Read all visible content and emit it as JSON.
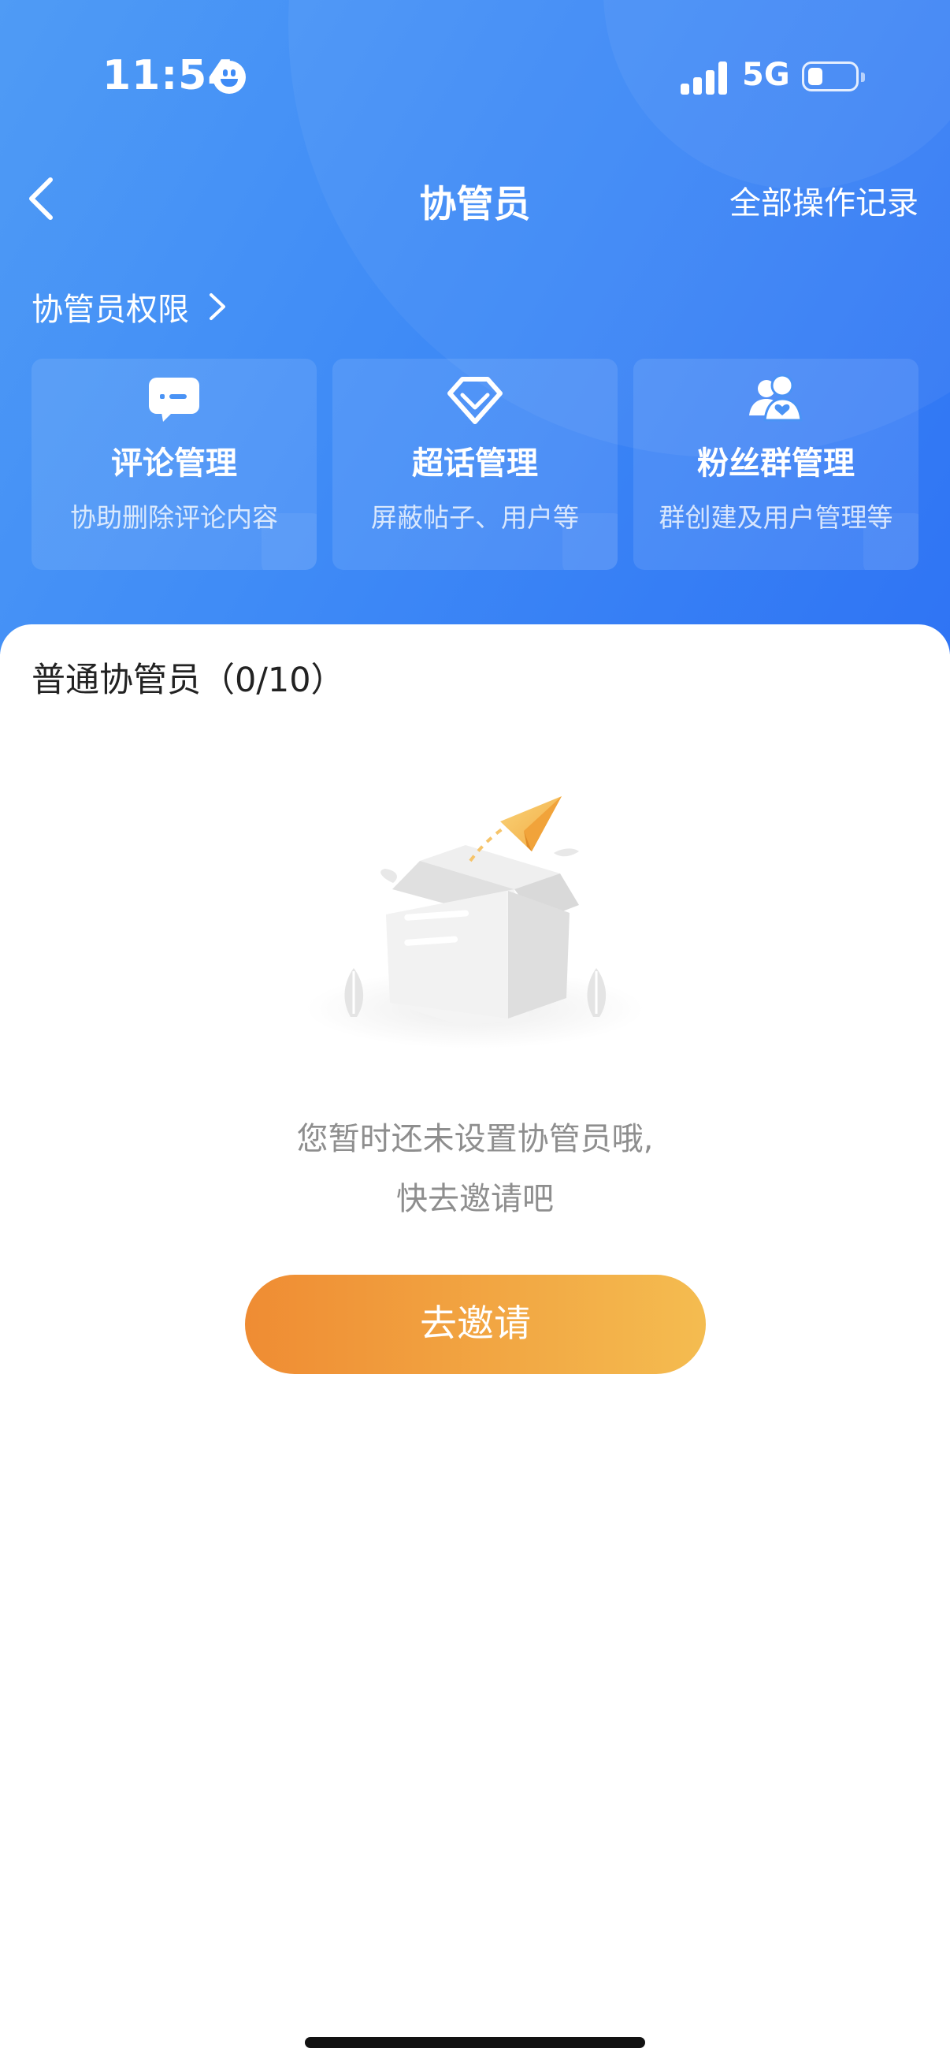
{
  "status_bar": {
    "time": "11:54",
    "network": "5G"
  },
  "nav": {
    "title": "协管员",
    "right_action": "全部操作记录"
  },
  "permissions": {
    "link_label": "协管员权限",
    "cards": [
      {
        "title": "评论管理",
        "desc": "协助删除评论内容",
        "icon": "comment-icon"
      },
      {
        "title": "超话管理",
        "desc": "屏蔽帖子、用户等",
        "icon": "diamond-icon"
      },
      {
        "title": "粉丝群管理",
        "desc": "群创建及用户管理等",
        "icon": "fans-group-icon"
      }
    ]
  },
  "section": {
    "title": "普通协管员（0/10）"
  },
  "empty_state": {
    "line1": "您暂时还未设置协管员哦,",
    "line2": "快去邀请吧",
    "illustration": "empty-box-paper-plane"
  },
  "invite_button": "去邀请",
  "colors": {
    "header_blue": "#3f8bf6",
    "button_orange_start": "#ef8c33",
    "button_orange_end": "#f4bc50",
    "muted_text": "#8e8e8e"
  }
}
